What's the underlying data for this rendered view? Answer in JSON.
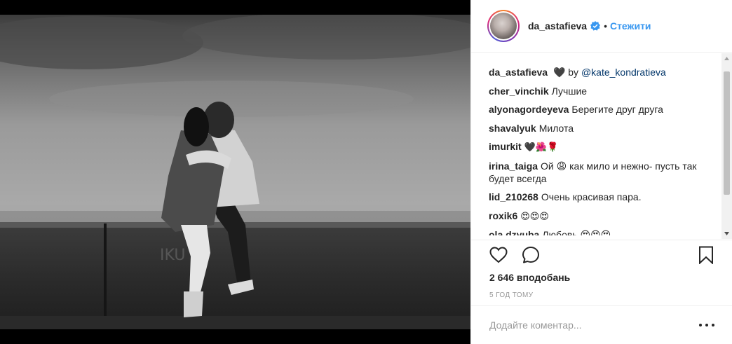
{
  "post": {
    "author": "da_astafieva",
    "follow_label": "Стежити",
    "separator": "•",
    "likes_text": "2 646 вподобань",
    "time_text": "5 ГОД ТОМУ",
    "comment_placeholder": "Додайте коментар..."
  },
  "caption": {
    "author": "da_astafieva",
    "text_before": "🖤  by ",
    "mention": "@kate_kondratieva"
  },
  "comments": [
    {
      "author": "cher_vinchik",
      "text": "Лучшие"
    },
    {
      "author": "alyonagordeyeva",
      "text": "Берегите друг друга"
    },
    {
      "author": "shavalyuk",
      "text": "Милота"
    },
    {
      "author": "imurkit",
      "text": "🖤🌺🌹"
    },
    {
      "author": "irina_taiga",
      "text": "Ой 😩 как мило и нежно- пусть так будет всегда"
    },
    {
      "author": "lid_210268",
      "text": "Очень красивая пара."
    },
    {
      "author": "roxik6",
      "text": "😍😍😍"
    },
    {
      "author": "ola.dzyuba",
      "text": "Любовь 😍😍😍"
    }
  ],
  "icons": {
    "like": "heart-icon",
    "comment": "comment-icon",
    "save": "bookmark-icon",
    "more": "more-options-icon",
    "verified": "verified-badge-icon"
  },
  "colors": {
    "link": "#3897f0",
    "mention": "#003569",
    "text": "#262626",
    "muted": "#999999"
  }
}
